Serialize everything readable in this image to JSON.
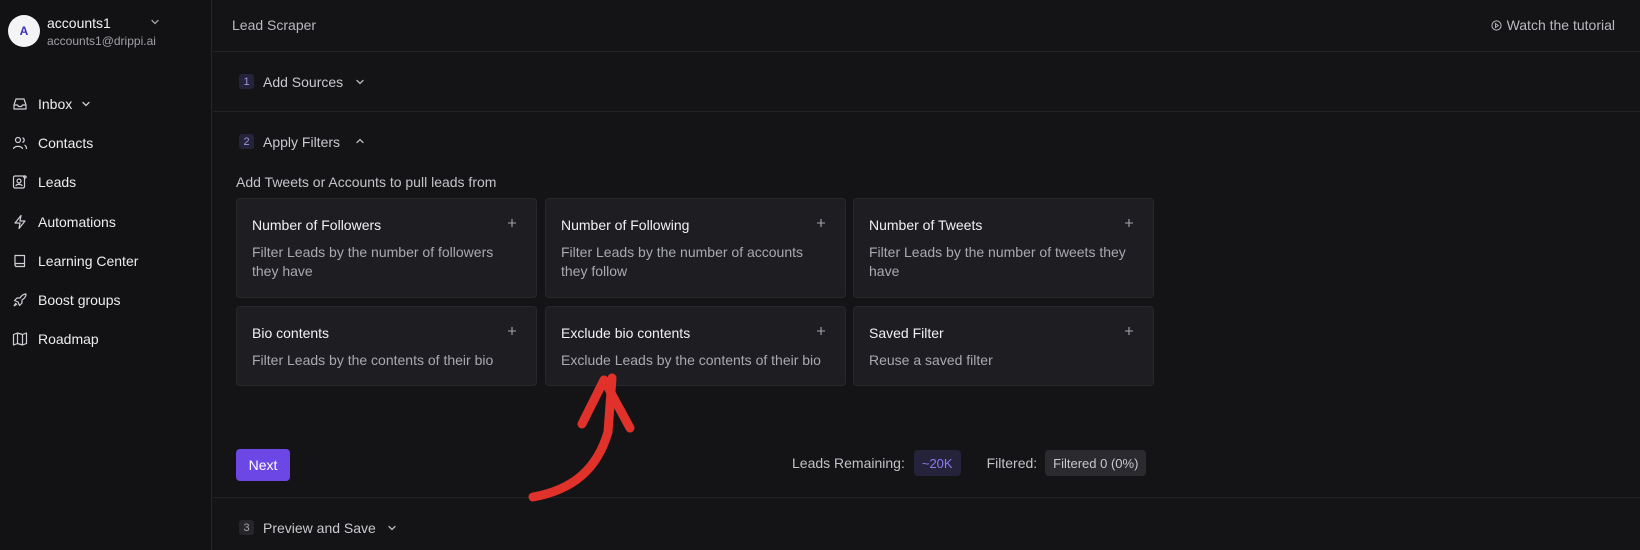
{
  "account": {
    "avatar_initial": "A",
    "name": "accounts1",
    "email": "accounts1@drippi.ai"
  },
  "nav": {
    "items": [
      {
        "label": "Inbox",
        "icon": "inbox-icon",
        "has_chevron": true
      },
      {
        "label": "Contacts",
        "icon": "users-icon"
      },
      {
        "label": "Leads",
        "icon": "user-plus-icon"
      },
      {
        "label": "Automations",
        "icon": "lightning-icon"
      },
      {
        "label": "Learning Center",
        "icon": "book-icon"
      },
      {
        "label": "Boost groups",
        "icon": "rocket-icon"
      },
      {
        "label": "Roadmap",
        "icon": "map-icon"
      }
    ]
  },
  "header": {
    "title": "Lead Scraper",
    "tutorial_label": "Watch the tutorial"
  },
  "steps": [
    {
      "number": "1",
      "label": "Add Sources",
      "expanded": false
    },
    {
      "number": "2",
      "label": "Apply Filters",
      "expanded": true
    },
    {
      "number": "3",
      "label": "Preview and Save",
      "expanded": false
    }
  ],
  "filters": {
    "description": "Add Tweets or Accounts to pull leads from",
    "cards": [
      {
        "title": "Number of Followers",
        "desc": "Filter Leads by the number of followers they have"
      },
      {
        "title": "Number of Following",
        "desc": "Filter Leads by the number of accounts they follow"
      },
      {
        "title": "Number of Tweets",
        "desc": "Filter Leads by the number of tweets they have"
      },
      {
        "title": "Bio contents",
        "desc": "Filter Leads by the contents of their bio"
      },
      {
        "title": "Exclude bio contents",
        "desc": "Exclude Leads by the contents of their bio"
      },
      {
        "title": "Saved Filter",
        "desc": "Reuse a saved filter"
      }
    ]
  },
  "footer": {
    "next_label": "Next",
    "leads_remaining_label": "Leads Remaining:",
    "leads_remaining_value": "~20K",
    "filtered_label": "Filtered:",
    "filtered_value": "Filtered 0 (0%)"
  },
  "colors": {
    "accent": "#6c47e6",
    "annotation_arrow": "#e0312a"
  }
}
